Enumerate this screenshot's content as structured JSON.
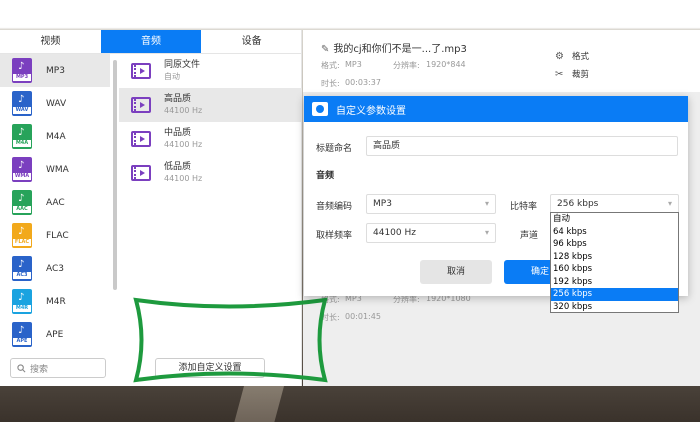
{
  "tabs": [
    "视频",
    "音频",
    "设备"
  ],
  "active_tab": 1,
  "formats": [
    {
      "name": "MP3",
      "tag": "MP3",
      "color": "#7b3fbf"
    },
    {
      "name": "WAV",
      "tag": "WAV",
      "color": "#2a63c9"
    },
    {
      "name": "M4A",
      "tag": "M4A",
      "color": "#27a35a"
    },
    {
      "name": "WMA",
      "tag": "WMA",
      "color": "#7b3fbf"
    },
    {
      "name": "AAC",
      "tag": "AAC",
      "color": "#27a35a"
    },
    {
      "name": "FLAC",
      "tag": "FLAC",
      "color": "#f2a91b"
    },
    {
      "name": "AC3",
      "tag": "AC3",
      "color": "#2a63c9"
    },
    {
      "name": "M4R",
      "tag": "M4R",
      "color": "#1aa3e0"
    },
    {
      "name": "APE",
      "tag": "APE",
      "color": "#2a63c9"
    }
  ],
  "search_placeholder": "搜索",
  "presets": [
    {
      "name": "同原文件",
      "sub": "自动"
    },
    {
      "name": "高品质",
      "sub": "44100 Hz"
    },
    {
      "name": "中品质",
      "sub": "44100 Hz"
    },
    {
      "name": "低品质",
      "sub": "44100 Hz"
    }
  ],
  "add_custom_label": "添加自定义设置",
  "file": {
    "title": "我的cj和你们不是一...了.mp3",
    "format_label": "格式:",
    "format_value": "MP3",
    "resolution_label": "分辨率:",
    "resolution_value": "1920*844",
    "duration_label": "时长:",
    "duration_value": "00:03:37"
  },
  "actions": {
    "format": "格式",
    "cut": "裁剪"
  },
  "file2": {
    "format_label": "格式:",
    "format_value": "MP3",
    "resolution_label": "分辨率:",
    "resolution_value": "1920*1080",
    "duration_label": "时长:",
    "duration_value": "00:01:45"
  },
  "dialog": {
    "title": "自定义参数设置",
    "name_label": "标题命名",
    "name_value": "高品质",
    "section_audio": "音频",
    "codec_label": "音频编码",
    "codec_value": "MP3",
    "bitrate_label": "比特率",
    "bitrate_value": "256 kbps",
    "sample_label": "取样频率",
    "sample_value": "44100 Hz",
    "channel_label": "声道",
    "cancel": "取消",
    "ok": "确定"
  },
  "bitrate_options": [
    "自动",
    "64 kbps",
    "96 kbps",
    "128 kbps",
    "160 kbps",
    "192 kbps",
    "256 kbps",
    "320 kbps"
  ],
  "bitrate_selected": 6,
  "colors": {
    "accent": "#0a7cf5",
    "highlight": "#1e9a3e"
  }
}
